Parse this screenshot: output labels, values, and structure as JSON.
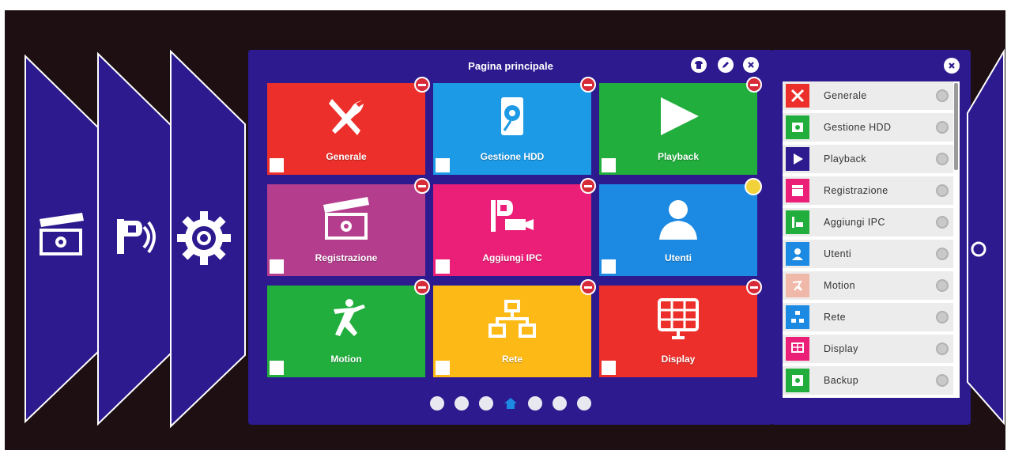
{
  "main": {
    "title": "Pagina principale",
    "tiles": [
      {
        "label": "Generale",
        "icon": "tools-icon",
        "color": "#ec2f2a"
      },
      {
        "label": "Gestione HDD",
        "icon": "hdd-icon",
        "color": "#1c9ae6"
      },
      {
        "label": "Playback",
        "icon": "play-icon",
        "color": "#21ae3c"
      },
      {
        "label": "Registrazione",
        "icon": "clapper-icon",
        "color": "#b43e8d"
      },
      {
        "label": "Aggiungi IPC",
        "icon": "ipc-camera-icon",
        "color": "#ec1f78"
      },
      {
        "label": "Utenti",
        "icon": "user-icon",
        "color": "#1c8ae2"
      },
      {
        "label": "Motion",
        "icon": "running-man-icon",
        "color": "#21ae3c"
      },
      {
        "label": "Rete",
        "icon": "network-icon",
        "color": "#fdb915"
      },
      {
        "label": "Display",
        "icon": "display-grid-icon",
        "color": "#ec2f2a"
      }
    ],
    "pages": 7,
    "current_page": 4
  },
  "list": {
    "items": [
      {
        "label": "Generale",
        "color": "#ec2f2a"
      },
      {
        "label": "Gestione HDD",
        "color": "#21ae3c"
      },
      {
        "label": "Playback",
        "color": "#2d1a8f"
      },
      {
        "label": "Registrazione",
        "color": "#ec1f78"
      },
      {
        "label": "Aggiungi IPC",
        "color": "#21ae3c"
      },
      {
        "label": "Utenti",
        "color": "#1c8ae2"
      },
      {
        "label": "Motion",
        "color": "#f0b8a8"
      },
      {
        "label": "Rete",
        "color": "#1c8ae2"
      },
      {
        "label": "Display",
        "color": "#ec1f78"
      },
      {
        "label": "Backup",
        "color": "#21ae3c"
      }
    ]
  }
}
